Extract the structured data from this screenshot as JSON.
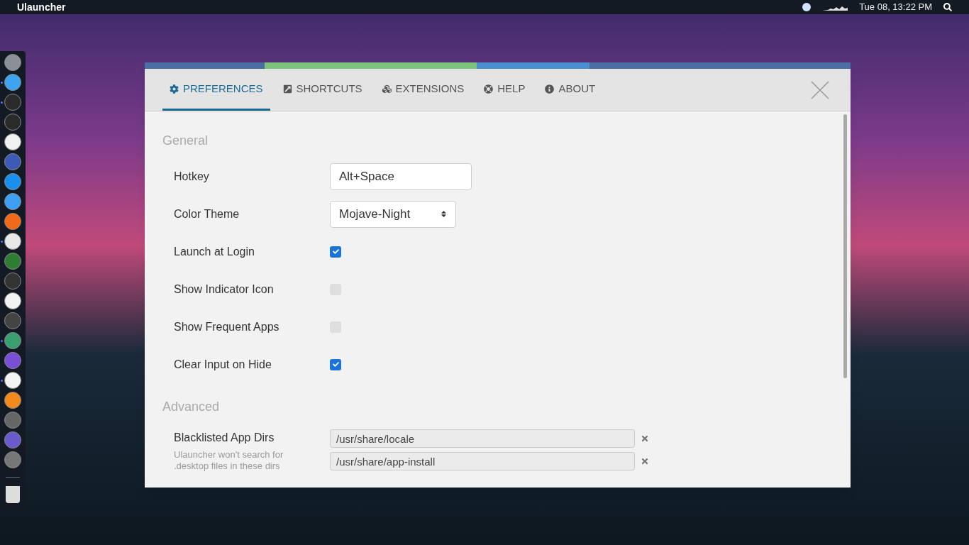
{
  "top_bar": {
    "app_name": "Ulauncher",
    "clock": "Tue 08, 13:22 PM"
  },
  "dock": {
    "items": [
      {
        "running": false
      },
      {
        "running": true
      },
      {
        "running": true
      },
      {
        "running": false
      },
      {
        "running": false
      },
      {
        "running": false
      },
      {
        "running": false
      },
      {
        "running": false
      },
      {
        "running": false
      },
      {
        "running": true
      },
      {
        "running": false
      },
      {
        "running": false
      },
      {
        "running": false
      },
      {
        "running": false
      },
      {
        "running": true
      },
      {
        "running": false
      },
      {
        "running": true
      },
      {
        "running": false
      },
      {
        "running": false
      },
      {
        "running": false
      },
      {
        "running": false
      }
    ]
  },
  "window": {
    "tabs": [
      {
        "label": "PREFERENCES",
        "kind": "gear",
        "selected": true
      },
      {
        "label": "SHORTCUTS",
        "kind": "shortcut",
        "selected": false
      },
      {
        "label": "EXTENSIONS",
        "kind": "cubes",
        "selected": false
      },
      {
        "label": "HELP",
        "kind": "lifebuoy",
        "selected": false
      },
      {
        "label": "ABOUT",
        "kind": "info",
        "selected": false
      }
    ],
    "sections": [
      {
        "title": "General",
        "rows": [
          {
            "kind": "text",
            "label": "Hotkey",
            "value": "Alt+Space"
          },
          {
            "kind": "select",
            "label": "Color Theme",
            "value": "Mojave-Night"
          },
          {
            "kind": "checkbox",
            "label": "Launch at Login",
            "checked": true
          },
          {
            "kind": "checkbox",
            "label": "Show Indicator Icon",
            "checked": false
          },
          {
            "kind": "checkbox",
            "label": "Show Frequent Apps",
            "checked": false
          },
          {
            "kind": "checkbox",
            "label": "Clear Input on Hide",
            "checked": true
          }
        ]
      },
      {
        "title": "Advanced",
        "rows": [
          {
            "kind": "list",
            "label": "Blacklisted App Dirs",
            "hint": "Ulauncher won't search for .desktop files in these dirs",
            "values": [
              "/usr/share/locale",
              "/usr/share/app-install"
            ]
          }
        ]
      }
    ]
  }
}
